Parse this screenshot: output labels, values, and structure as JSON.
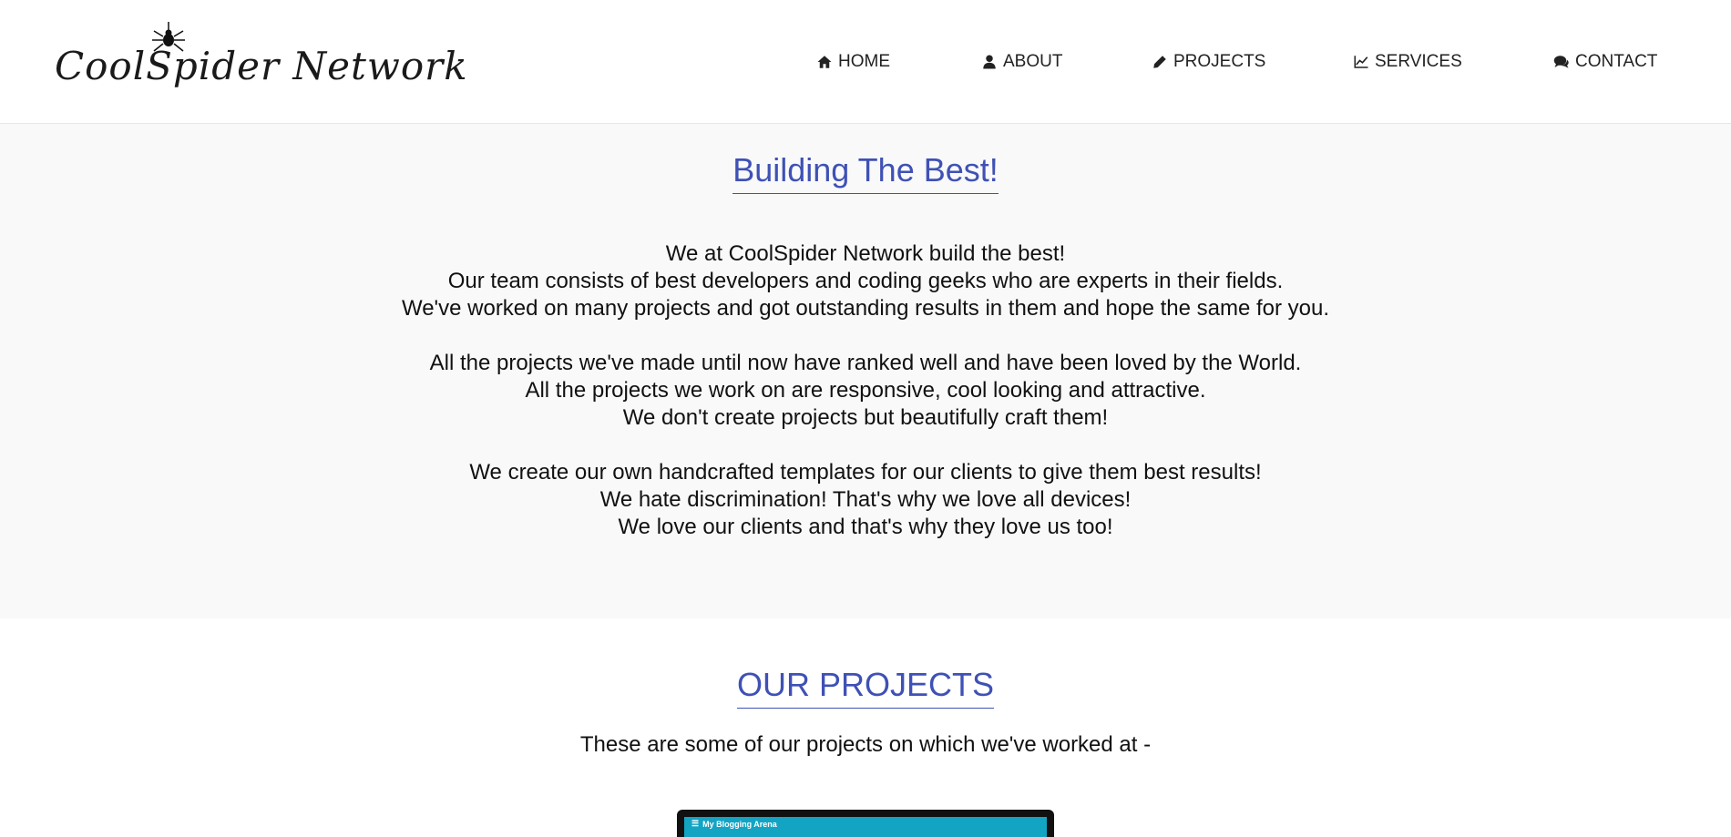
{
  "brand": {
    "name": "CoolSpider Network"
  },
  "nav": {
    "items": [
      {
        "label": "HOME",
        "icon": "home-icon"
      },
      {
        "label": "ABOUT",
        "icon": "user-icon"
      },
      {
        "label": "PROJECTS",
        "icon": "pencil-icon"
      },
      {
        "label": "SERVICES",
        "icon": "line-chart-icon"
      },
      {
        "label": "CONTACT",
        "icon": "comments-icon"
      }
    ]
  },
  "intro": {
    "title": "Building The Best!",
    "paragraphs": [
      [
        "We at CoolSpider Network build the best!",
        "Our team consists of best developers and coding geeks who are experts in their fields.",
        "We've worked on many projects and got outstanding results in them and hope the same for you."
      ],
      [
        "All the projects we've made until now have ranked well and have been loved by the World.",
        "All the projects we work on are responsive, cool looking and attractive.",
        "We don't create projects but beautifully craft them!"
      ],
      [
        "We create our own handcrafted templates for our clients to give them best results!",
        "We hate discrimination! That's why we love all devices!",
        "We love our clients and that's why they love us too!"
      ]
    ]
  },
  "projects": {
    "title": "OUR PROJECTS",
    "subtitle": "These are some of our projects on which we've worked at -",
    "preview_title": "My Blogging Arena"
  },
  "colors": {
    "accent": "#3f51b5",
    "intro_bg": "#f9f9f9",
    "preview_bar": "#13a4c4"
  }
}
